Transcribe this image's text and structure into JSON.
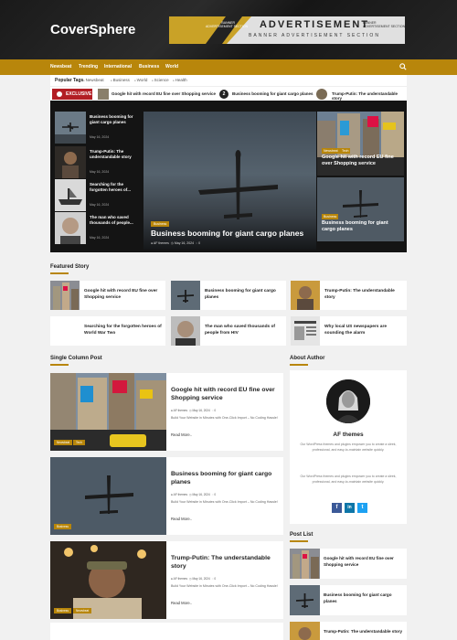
{
  "site": {
    "logo": "CoverSphere"
  },
  "ad": {
    "title": "ADVERTISEMENT",
    "subtitle": "BANNER ADVERTISEMENT SECTION",
    "small_left": "BANNER\nADVERTISEMENT SECTION",
    "small_right": "BANNER\nADVERTISEMENT SECTION"
  },
  "nav": {
    "items": [
      "Newsbeat",
      "Trending",
      "International",
      "Business",
      "World"
    ]
  },
  "tags": {
    "label": "Popular Tags",
    "items": [
      "Newsbeat",
      "Business",
      "World",
      "Science",
      "Health"
    ]
  },
  "exclusive": {
    "label": "EXCLUSIVE",
    "items": [
      {
        "num": "1",
        "title": "Google hit with record EU fine over Shopping service"
      },
      {
        "num": "2",
        "title": "Business booming for giant cargo planes"
      },
      {
        "num": "3",
        "title": "Trump-Putin: The understandable story"
      }
    ]
  },
  "hero": {
    "left": [
      {
        "title": "Business booming for giant cargo planes",
        "date": "May 16, 2024"
      },
      {
        "title": "Trump-Putin: The understandable story",
        "date": "May 16, 2024"
      },
      {
        "title": "Searching for the forgotten heroes of...",
        "date": "May 16, 2024"
      },
      {
        "title": "The man who saved thousands of people...",
        "date": "May 16, 2024"
      }
    ],
    "main": {
      "category": "Business",
      "title": "Business booming for giant cargo planes",
      "author": "AF themes",
      "date": "May 16, 2024",
      "comments": "0"
    },
    "right": [
      {
        "categories": [
          "Newsbeat",
          "Tech"
        ],
        "title": "Google hit with record EU fine over Shopping service",
        "author": "AF themes",
        "date": "May 16, 2024",
        "comments": "0"
      },
      {
        "categories": [
          "Business"
        ],
        "title": "Business booming for giant cargo planes",
        "author": "AF themes",
        "date": "May 16, 2024",
        "comments": "0"
      }
    ]
  },
  "featured": {
    "title": "Featured Story",
    "items": [
      {
        "title": "Google hit with record EU fine over Shopping service"
      },
      {
        "title": "Business booming for giant cargo planes"
      },
      {
        "title": "Trump-Putin: The understandable story"
      },
      {
        "title": "Searching for the forgotten heroes of World War Two"
      },
      {
        "title": "The man who saved thousands of people from HIV"
      },
      {
        "title": "Why local US newspapers are sounding the alarm"
      }
    ]
  },
  "single_column": {
    "title": "Single Column Post",
    "posts": [
      {
        "title": "Google hit with record EU fine over Shopping service",
        "author": "AF themes",
        "date": "May 16, 2024",
        "comments": "0",
        "excerpt": "Build Your Website in Minutes with One-Click Import – No Coding Hassle!",
        "more": "Read More..",
        "categories": [
          "Newsbeat",
          "Tech"
        ]
      },
      {
        "title": "Business booming for giant cargo planes",
        "author": "AF themes",
        "date": "May 16, 2024",
        "comments": "0",
        "excerpt": "Build Your Website in Minutes with One-Click Import – No Coding Hassle!",
        "more": "Read More..",
        "categories": [
          "Business"
        ]
      },
      {
        "title": "Trump-Putin: The understandable story",
        "author": "AF themes",
        "date": "May 16, 2024",
        "comments": "0",
        "excerpt": "Build Your Website in Minutes with One-Click Import – No Coding Hassle!",
        "more": "Read More..",
        "categories": [
          "Business",
          "Newsbeat"
        ]
      }
    ]
  },
  "about": {
    "title": "About Author",
    "name": "AF themes",
    "desc1": "Our WordPress themes and plugins empower you to create a sleek, professional, and easy-to-maintain website quickly.",
    "desc2": "Our WordPress themes and plugins empower you to create a sleek, professional, and easy-to-maintain website quickly.",
    "social": [
      "f",
      "in",
      "t"
    ]
  },
  "post_list": {
    "title": "Post List",
    "items": [
      {
        "title": "Google hit with record EU fine over Shopping service"
      },
      {
        "title": "Business booming for giant cargo planes"
      },
      {
        "title": "Trump-Putin: The understandable story"
      }
    ]
  }
}
